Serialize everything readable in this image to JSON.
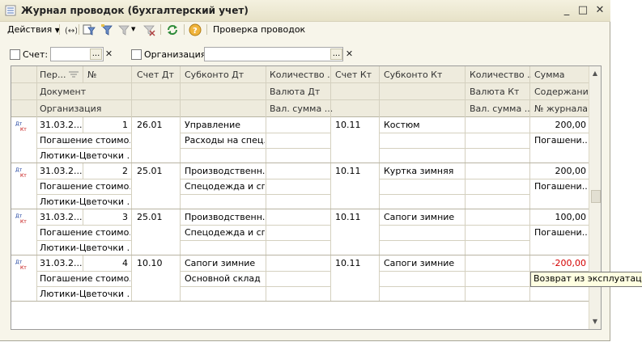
{
  "window": {
    "title": "Журнал проводок (бухгалтерский учет)",
    "min": "_",
    "max": "□",
    "close": "✕"
  },
  "toolbar": {
    "actions_label": "Действия",
    "check_label": "Проверка проводок"
  },
  "filters": {
    "account_label": "Счет:",
    "org_label": "Организация:",
    "btn": "...",
    "clear": "✕"
  },
  "columns": {
    "period": "Пер...",
    "number": "№",
    "document": "Документ",
    "organization": "Организация",
    "acct_dt": "Счет Дт",
    "subk_dt": "Субконто Дт",
    "qty_dt": "Количество ...",
    "cur_dt": "Валюта Дт",
    "cursum_dt": "Вал. сумма ...",
    "acct_kt": "Счет Кт",
    "subk_kt": "Субконто Кт",
    "qty_kt": "Количество ...",
    "cur_kt": "Валюта Кт",
    "cursum_kt": "Вал. сумма ...",
    "sum": "Сумма",
    "content": "Содержание",
    "journal_no": "№ журнала"
  },
  "rows": [
    {
      "date": "31.03.2...",
      "num": "1",
      "doc": "Погашение стоимо...",
      "org": "Лютики-Цветочки ...",
      "acct_dt": "26.01",
      "subk_dt_1": "Управление",
      "subk_dt_2": "Расходы на спец...",
      "acct_kt": "10.11",
      "subk_kt_1": "Костюм",
      "sum": "200,00",
      "content": "Погашени..."
    },
    {
      "date": "31.03.2...",
      "num": "2",
      "doc": "Погашение стоимо...",
      "org": "Лютики-Цветочки ...",
      "acct_dt": "25.01",
      "subk_dt_1": "Производственн...",
      "subk_dt_2": "Спецодежда и сп...",
      "acct_kt": "10.11",
      "subk_kt_1": "Куртка зимняя",
      "sum": "200,00",
      "content": "Погашени..."
    },
    {
      "date": "31.03.2...",
      "num": "3",
      "doc": "Погашение стоимо...",
      "org": "Лютики-Цветочки ...",
      "acct_dt": "25.01",
      "subk_dt_1": "Производственн...",
      "subk_dt_2": "Спецодежда и сп...",
      "acct_kt": "10.11",
      "subk_kt_1": "Сапоги зимние",
      "sum": "100,00",
      "content": "Погашени..."
    },
    {
      "date": "31.03.2...",
      "num": "4",
      "doc": "Погашение стоимо...",
      "org": "Лютики-Цветочки ...",
      "acct_dt": "10.10",
      "subk_dt_1": "Сапоги зимние",
      "subk_dt_2": "Основной склад",
      "acct_kt": "10.11",
      "subk_kt_1": "Сапоги зимние",
      "sum": "-200,00",
      "content": ""
    }
  ],
  "row_icon": {
    "top": "Дт",
    "bottom": "Кт"
  },
  "tooltip": "Возврат из эксплуатации",
  "colors": {
    "negative": "#d40000",
    "icon_red": "#c00000",
    "icon_blue": "#1b3f9e"
  }
}
